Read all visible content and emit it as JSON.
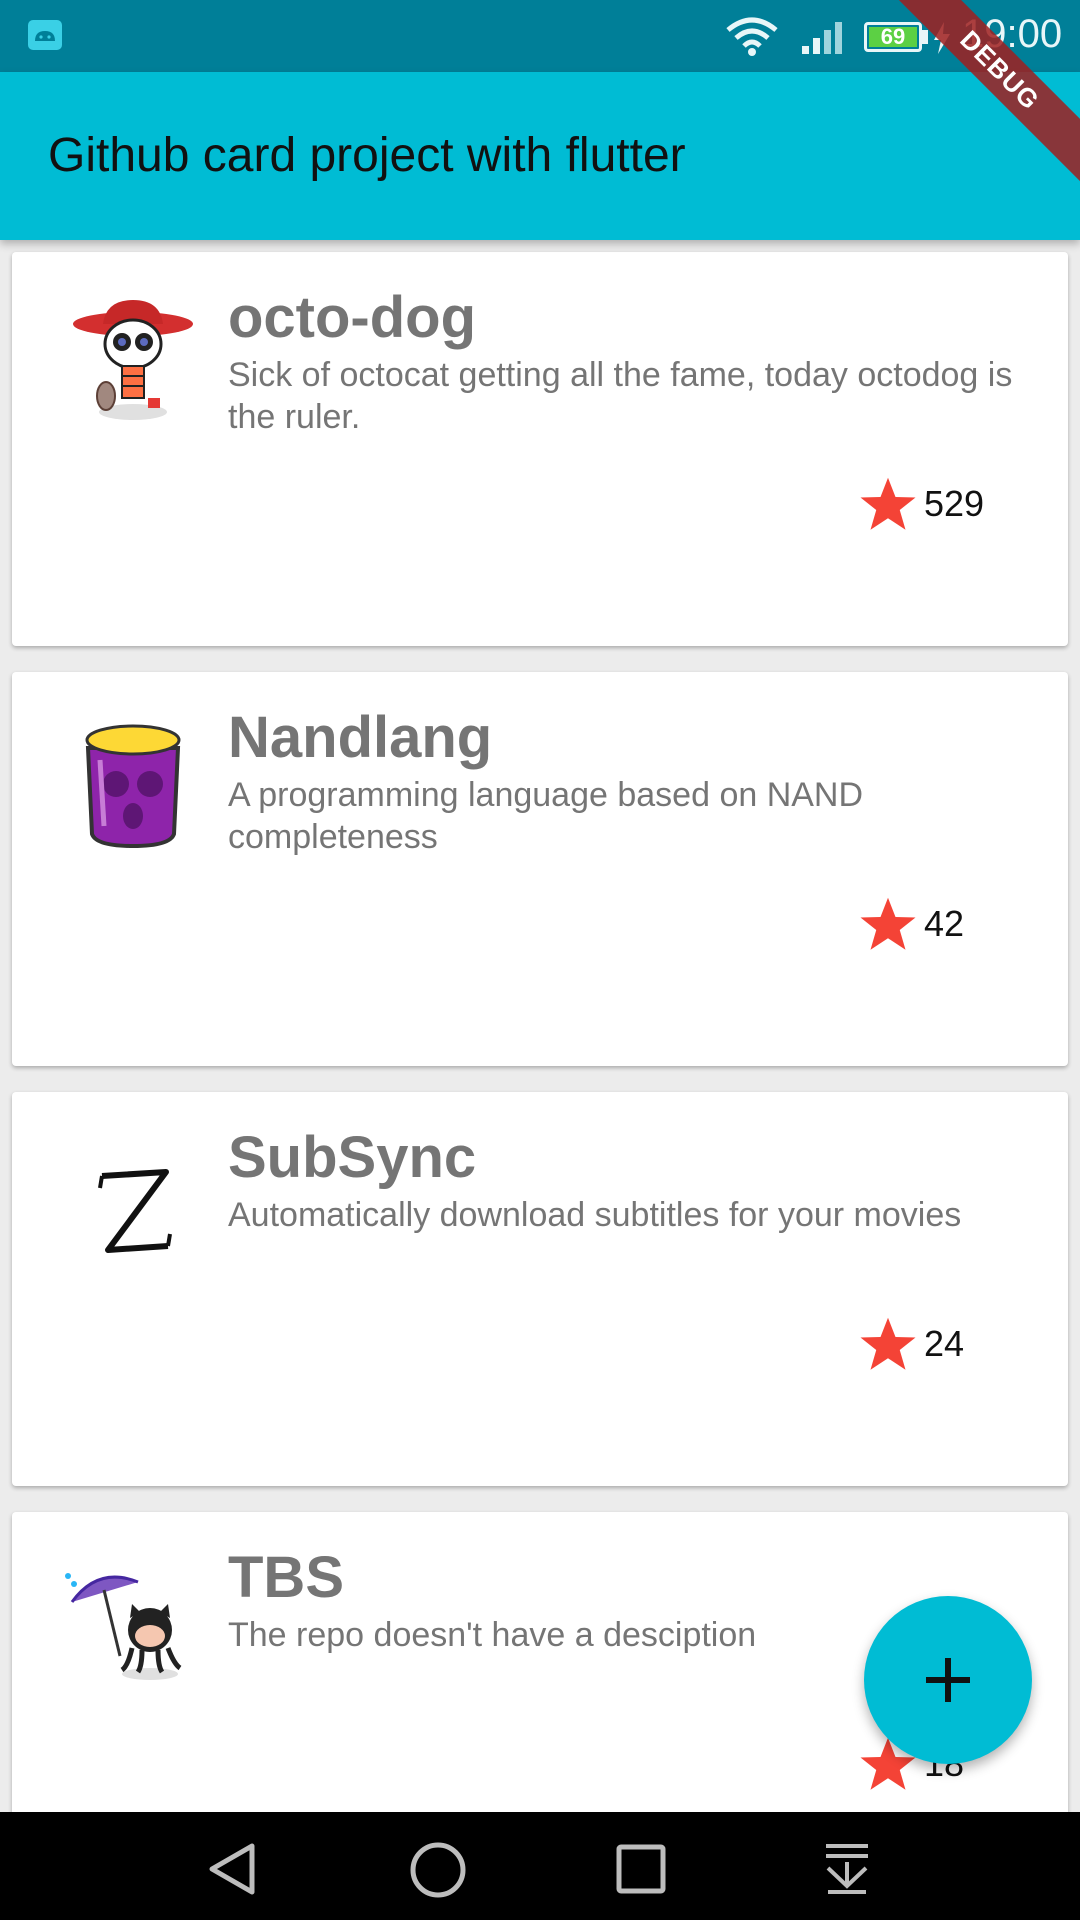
{
  "status_bar": {
    "time": "19:00",
    "battery_level": "69",
    "icons": [
      "android-notification-icon",
      "wifi-icon",
      "signal-icon",
      "battery-icon",
      "charging-bolt-icon"
    ]
  },
  "app_bar": {
    "title": "Github card project  with flutter"
  },
  "debug_banner": "DEBUG",
  "repos": [
    {
      "name": "octo-dog",
      "description": "Sick of octocat getting all the fame, today octodog is the ruler.",
      "stars": "529",
      "avatar_icon": "sugar-skull-octocat-icon"
    },
    {
      "name": "Nandlang",
      "description": "A programming language based on NAND completeness",
      "stars": "42",
      "avatar_icon": "purple-jar-icon"
    },
    {
      "name": "SubSync",
      "description": "Automatically download subtitles for your movies",
      "stars": "24",
      "avatar_icon": "letter-z-icon"
    },
    {
      "name": "TBS",
      "description": "The repo doesn't have a desciption",
      "stars": "18",
      "avatar_icon": "umbrella-octocat-icon"
    }
  ],
  "colors": {
    "status_bar": "#007f98",
    "primary": "#00bcd4",
    "star": "#f44336",
    "text_secondary": "#757575"
  },
  "fab": {
    "icon": "plus-icon"
  },
  "nav_bar": {
    "icons": [
      "back-icon",
      "home-icon",
      "recents-icon",
      "notification-pull-icon"
    ]
  }
}
